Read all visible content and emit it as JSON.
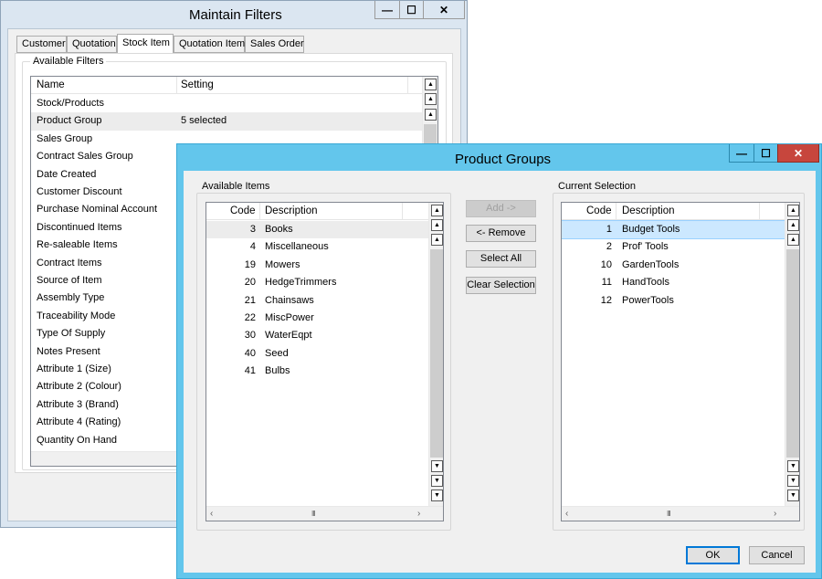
{
  "maintain_filters": {
    "title": "Maintain Filters",
    "tabs": [
      "Customer",
      "Quotation",
      "Stock Item",
      "Quotation Item",
      "Sales Order"
    ],
    "active_tab": "Stock Item",
    "group_label": "Available Filters",
    "columns": [
      "Name",
      "Setting"
    ],
    "rows": [
      {
        "name": "Stock/Products",
        "setting": ""
      },
      {
        "name": "Product Group",
        "setting": "5 selected"
      },
      {
        "name": "Sales Group",
        "setting": ""
      },
      {
        "name": "Contract Sales Group",
        "setting": ""
      },
      {
        "name": "Date Created",
        "setting": ""
      },
      {
        "name": "Customer Discount",
        "setting": ""
      },
      {
        "name": "Purchase Nominal Account",
        "setting": ""
      },
      {
        "name": "Discontinued Items",
        "setting": ""
      },
      {
        "name": "Re-saleable Items",
        "setting": ""
      },
      {
        "name": "Contract Items",
        "setting": ""
      },
      {
        "name": "Source of Item",
        "setting": ""
      },
      {
        "name": "Assembly Type",
        "setting": ""
      },
      {
        "name": "Traceability Mode",
        "setting": ""
      },
      {
        "name": "Type Of Supply",
        "setting": ""
      },
      {
        "name": "Notes Present",
        "setting": ""
      },
      {
        "name": "Attribute 1 (Size)",
        "setting": ""
      },
      {
        "name": "Attribute 2 (Colour)",
        "setting": ""
      },
      {
        "name": "Attribute 3 (Brand)",
        "setting": ""
      },
      {
        "name": "Attribute 4 (Rating)",
        "setting": ""
      },
      {
        "name": "Quantity On Hand",
        "setting": ""
      }
    ],
    "selected_row": "Product Group"
  },
  "product_groups": {
    "title": "Product Groups",
    "available": {
      "label": "Available Items",
      "columns": [
        "Code",
        "Description"
      ],
      "rows": [
        {
          "code": "3",
          "description": "Books"
        },
        {
          "code": "4",
          "description": "Miscellaneous"
        },
        {
          "code": "19",
          "description": "Mowers"
        },
        {
          "code": "20",
          "description": "HedgeTrimmers"
        },
        {
          "code": "21",
          "description": "Chainsaws"
        },
        {
          "code": "22",
          "description": "MiscPower"
        },
        {
          "code": "30",
          "description": "WaterEqpt"
        },
        {
          "code": "40",
          "description": "Seed"
        },
        {
          "code": "41",
          "description": "Bulbs"
        }
      ]
    },
    "current": {
      "label": "Current Selection",
      "columns": [
        "Code",
        "Description"
      ],
      "rows": [
        {
          "code": "1",
          "description": "Budget Tools"
        },
        {
          "code": "2",
          "description": "Prof' Tools"
        },
        {
          "code": "10",
          "description": "GardenTools"
        },
        {
          "code": "11",
          "description": "HandTools"
        },
        {
          "code": "12",
          "description": "PowerTools"
        }
      ]
    },
    "buttons": {
      "add": "Add ->",
      "remove": "<- Remove",
      "select_all": "Select All",
      "clear_selection": "Clear Selection",
      "ok": "OK",
      "cancel": "Cancel"
    },
    "hscroll_grip": "III"
  },
  "caption_buttons": {
    "minimize": "—",
    "maximize": "☐",
    "close": "✕"
  },
  "colors": {
    "back_window_frame": "#e0e9f2",
    "front_window_frame": "#63c6ec",
    "window_face": "#f0f0f0",
    "selected_row": "#cce8ff",
    "gray_row": "#ececec"
  }
}
